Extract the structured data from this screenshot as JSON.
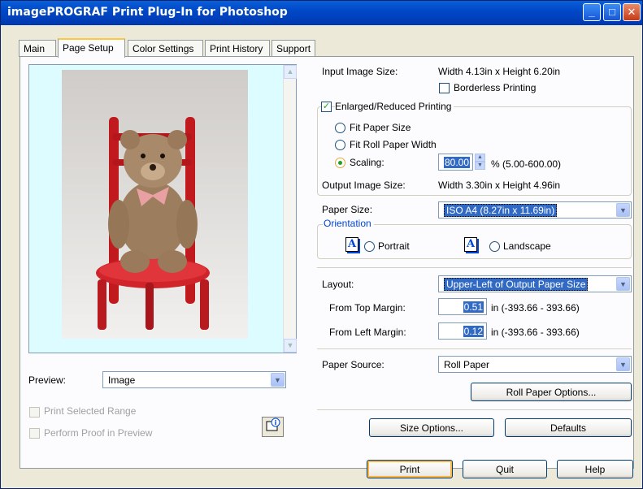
{
  "window": {
    "title": "imagePROGRAF Print Plug-In for Photoshop"
  },
  "tabs": [
    "Main",
    "Page Setup",
    "Color Settings",
    "Print History",
    "Support"
  ],
  "input_image_size": {
    "label": "Input Image Size:",
    "value": "Width 4.13in x Height 6.20in"
  },
  "borderless": {
    "label": "Borderless Printing",
    "checked": false
  },
  "enlarged": {
    "label": "Enlarged/Reduced Printing",
    "checked": true
  },
  "radios": {
    "fit_paper": "Fit Paper Size",
    "fit_roll": "Fit Roll Paper Width",
    "scaling": "Scaling:"
  },
  "scaling": {
    "value": "80.00",
    "range": "% (5.00-600.00)"
  },
  "output_image_size": {
    "label": "Output Image Size:",
    "value": "Width 3.30in x Height 4.96in"
  },
  "paper_size": {
    "label": "Paper Size:",
    "value": "ISO A4 (8.27in x 11.69in)"
  },
  "orientation": {
    "label": "Orientation",
    "portrait": "Portrait",
    "landscape": "Landscape",
    "icon_letter": "A"
  },
  "layout": {
    "label": "Layout:",
    "value": "Upper-Left of Output Paper Size"
  },
  "top_margin": {
    "label": "From Top Margin:",
    "value": "0.51",
    "range": "in (-393.66 - 393.66)"
  },
  "left_margin": {
    "label": "From Left Margin:",
    "value": "0.12",
    "range": "in (-393.66 - 393.66)"
  },
  "paper_source": {
    "label": "Paper Source:",
    "value": "Roll Paper"
  },
  "buttons": {
    "roll_options": "Roll Paper Options...",
    "size_options": "Size Options...",
    "defaults": "Defaults",
    "print": "Print",
    "quit": "Quit",
    "help": "Help"
  },
  "preview": {
    "label": "Preview:",
    "value": "Image"
  },
  "print_selected_range": {
    "label": "Print Selected Range",
    "checked": false
  },
  "perform_proof": {
    "label": "Perform Proof in Preview",
    "checked": false
  }
}
